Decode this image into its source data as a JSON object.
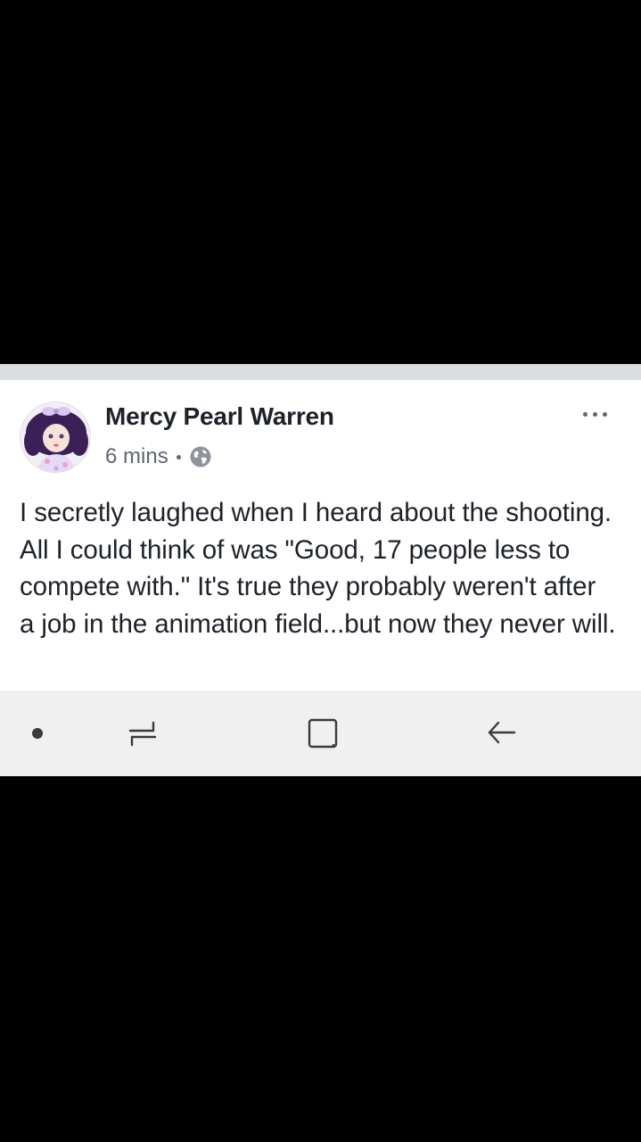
{
  "post": {
    "author": "Mercy Pearl Warren",
    "timestamp": "6 mins",
    "privacy_icon": "globe-icon",
    "more_icon": "more-options-icon",
    "text": "I secretly laughed when I heard about the shooting. All I could think of was \"Good, 17 people less to compete with.\" It's true they probably weren't after a job in the animation field...but now they never will."
  },
  "navbar": {
    "items": [
      {
        "icon": "dot-indicator-icon"
      },
      {
        "icon": "recent-apps-icon"
      },
      {
        "icon": "home-icon"
      },
      {
        "icon": "back-icon"
      }
    ]
  },
  "colors": {
    "background": "#000000",
    "card": "#ffffff",
    "separator": "#dadde1",
    "text_primary": "#1d2129",
    "text_secondary": "#606770",
    "navbar": "#f0f0f0"
  }
}
